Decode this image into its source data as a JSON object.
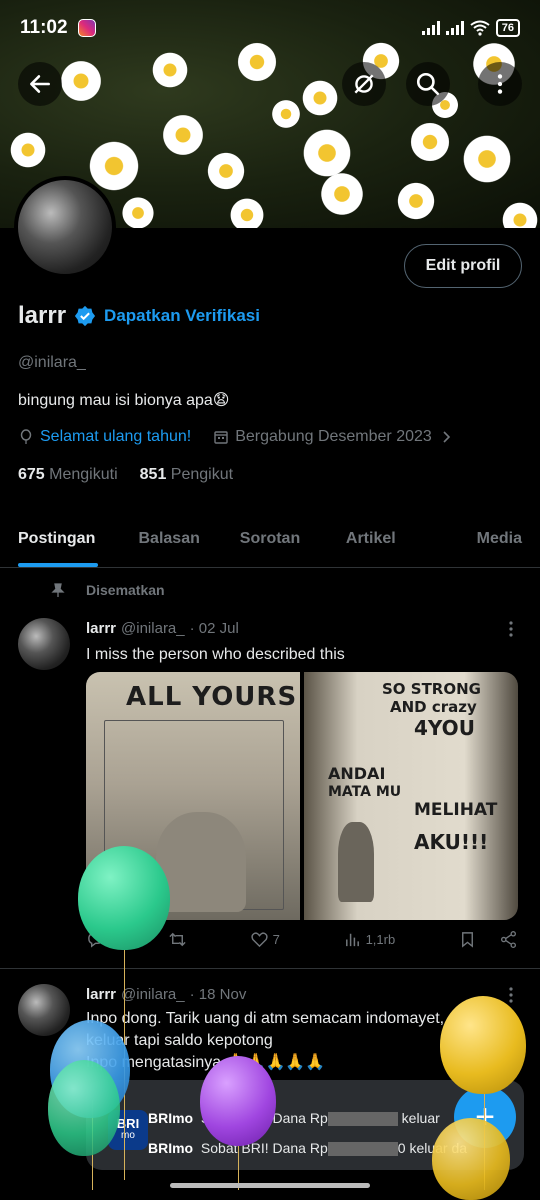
{
  "status_bar": {
    "time": "11:02",
    "battery": "76"
  },
  "profile": {
    "name": "larrr",
    "get_verified": "Dapatkan Verifikasi",
    "handle": "@inilara_",
    "bio": "bingung mau isi bionya apa😧",
    "birthday": "Selamat ulang tahun!",
    "joined": "Bergabung Desember 2023",
    "following_count": "675",
    "following_label": "Mengikuti",
    "followers_count": "851",
    "followers_label": "Pengikut",
    "edit_label": "Edit profil"
  },
  "tabs": [
    "Postingan",
    "Balasan",
    "Sorotan",
    "Artikel",
    "Media"
  ],
  "pinned_label": "Disematkan",
  "posts": [
    {
      "name": "larrr",
      "handle": "@inilara_",
      "date": "· 02 Jul",
      "text": "I miss the person who described this",
      "image1_text": "ALL YOURS",
      "image2_lines": [
        "SO STRONG",
        "AND crazy",
        "4YOU",
        "ANDAI",
        "MATA MU",
        "MELIHAT",
        "AKU!!!"
      ],
      "likes": "7",
      "views": "1,1rb"
    },
    {
      "name": "larrr",
      "handle": "@inilara_",
      "date": "· 18 Nov",
      "text": "Inpo dong. Tarik uang di atm semacam indomayet, uang ga keluar tapi saldo kepotong",
      "text2": "Inpo mengatasinya 🙏🙏🙏🙏🙏"
    }
  ],
  "notification": {
    "app": "BRImo",
    "logo_top": "BRI",
    "logo_bottom": "mo",
    "line1_a": "Sobat BRI! Dana Rp",
    "line1_b": "keluar",
    "line2_a": "Sobat BRI! Dana Rp",
    "line2_b": "0 keluar da"
  },
  "icons": {
    "back": "back-arrow-icon",
    "no_notif": "muted-icon",
    "search": "search-icon",
    "more": "more-vertical-icon"
  },
  "colors": {
    "accent": "#1d9bf0",
    "bg": "#000000",
    "muted": "#71767b"
  }
}
